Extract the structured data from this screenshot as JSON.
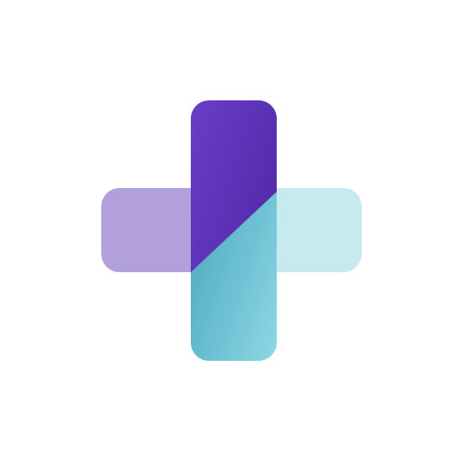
{
  "logo": {
    "icon": "medical-cross-icon",
    "colors": {
      "bar_left": "#b1a0dc",
      "bar_right": "#c6eaef",
      "vertical_top_start": "#6a3ec8",
      "vertical_top_end": "#4a22a0",
      "vertical_bottom_start": "#3a9eb2",
      "vertical_bottom_end": "#8ed7e6"
    }
  }
}
